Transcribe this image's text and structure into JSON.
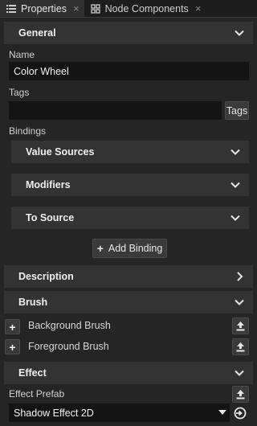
{
  "tabs": [
    {
      "label": "Properties",
      "close": "×",
      "icon": "list-icon"
    },
    {
      "label": "Node Components",
      "close": "×",
      "icon": "components-icon"
    }
  ],
  "general": {
    "title": "General",
    "name_label": "Name",
    "name_value": "Color Wheel",
    "tags_label": "Tags",
    "tags_value": "",
    "tags_button": "Tags",
    "bindings_label": "Bindings",
    "bindings": {
      "value_sources": "Value Sources",
      "modifiers": "Modifiers",
      "to_source": "To Source",
      "add_binding": "Add Binding"
    }
  },
  "description": {
    "title": "Description"
  },
  "brush": {
    "title": "Brush",
    "items": [
      {
        "label": "Background Brush"
      },
      {
        "label": "Foreground Brush"
      }
    ]
  },
  "effect": {
    "title": "Effect",
    "prefab_label": "Effect Prefab",
    "prefab_value": "Shadow Effect 2D"
  },
  "colors": {
    "background": "#252525",
    "header": "#333333",
    "field": "#141414",
    "text": "#d6d6d6"
  }
}
